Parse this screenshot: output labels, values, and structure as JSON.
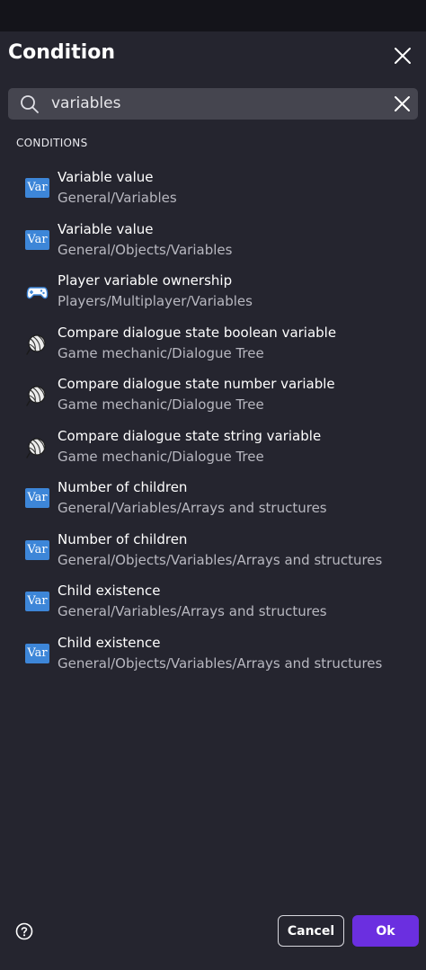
{
  "dialog": {
    "title": "Condition",
    "close_icon": "close-icon"
  },
  "search": {
    "value": "variables",
    "search_icon": "search-icon",
    "clear_icon": "clear-icon"
  },
  "section": {
    "label": "CONDITIONS"
  },
  "items": [
    {
      "name": "Variable value",
      "path": "General/Variables",
      "icon": "variable-icon"
    },
    {
      "name": "Variable value",
      "path": "General/Objects/Variables",
      "icon": "variable-icon"
    },
    {
      "name": "Player variable ownership",
      "path": "Players/Multiplayer/Variables",
      "icon": "gamepad-icon"
    },
    {
      "name": "Compare dialogue state boolean variable",
      "path": "Game mechanic/Dialogue Tree",
      "icon": "yarn-ball-icon"
    },
    {
      "name": "Compare dialogue state number variable",
      "path": "Game mechanic/Dialogue Tree",
      "icon": "yarn-ball-icon"
    },
    {
      "name": "Compare dialogue state string variable",
      "path": "Game mechanic/Dialogue Tree",
      "icon": "yarn-ball-icon"
    },
    {
      "name": "Number of children",
      "path": "General/Variables/Arrays and structures",
      "icon": "variable-icon"
    },
    {
      "name": "Number of children",
      "path": "General/Objects/Variables/Arrays and structures",
      "icon": "variable-icon"
    },
    {
      "name": "Child existence",
      "path": "General/Variables/Arrays and structures",
      "icon": "variable-icon"
    },
    {
      "name": "Child existence",
      "path": "General/Objects/Variables/Arrays and structures",
      "icon": "variable-icon"
    }
  ],
  "icon_text": {
    "variable": "Var"
  },
  "footer": {
    "help_icon": "help-icon",
    "cancel_label": "Cancel",
    "ok_label": "Ok"
  },
  "colors": {
    "background": "#25252f",
    "topbar": "#14141a",
    "search_bg": "#45454f",
    "primary": "#6b2fe0",
    "variable_icon": "#3d86d8",
    "secondary_text": "#b8b8c0"
  }
}
